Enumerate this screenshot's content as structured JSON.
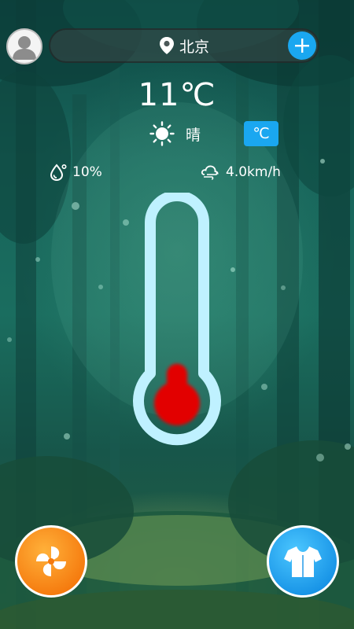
{
  "header": {
    "city": "北京",
    "avatar_icon": "user-icon",
    "location_icon": "location-pin-icon",
    "add_icon": "plus-icon"
  },
  "weather": {
    "temperature": "11℃",
    "condition": "晴",
    "condition_icon": "sun-icon",
    "unit_toggle": "℃",
    "humidity": "10%",
    "humidity_icon": "water-drop-icon",
    "wind": "4.0km/h",
    "wind_icon": "wind-icon",
    "thermometer_level": 0.2
  },
  "actions": {
    "left_icon": "fan-icon",
    "right_icon": "clothes-icon"
  },
  "colors": {
    "accent": "#1aa7f0",
    "thermometer_outline": "#bff1ff",
    "mercury": "#e00000",
    "fan_button": "#f57a0e",
    "clothes_button": "#1793e6"
  }
}
